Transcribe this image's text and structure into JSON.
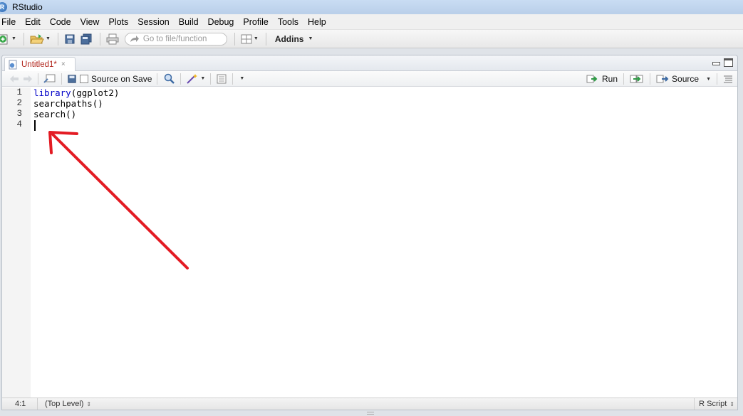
{
  "window": {
    "title": "RStudio",
    "app_icon": "R"
  },
  "menu": [
    "File",
    "Edit",
    "Code",
    "View",
    "Plots",
    "Session",
    "Build",
    "Debug",
    "Profile",
    "Tools",
    "Help"
  ],
  "toolbar": {
    "goto_placeholder": "Go to file/function",
    "addins_label": "Addins"
  },
  "editor": {
    "tab_label": "Untitled1*",
    "tab_close": "×",
    "source_on_save_label": "Source on Save",
    "run_label": "Run",
    "source_label": "Source",
    "lines": [
      {
        "num": "1",
        "kw": "library",
        "rest": "(ggplot2)"
      },
      {
        "num": "2",
        "kw": "",
        "rest": "searchpaths()"
      },
      {
        "num": "3",
        "kw": "",
        "rest": "search()"
      },
      {
        "num": "4",
        "kw": "",
        "rest": ""
      }
    ]
  },
  "status": {
    "position": "4:1",
    "scope": "(Top Level)",
    "file_type": "R Script"
  },
  "colors": {
    "keyword": "#0000c8",
    "annotation_arrow": "#e31b23",
    "tab_label": "#b1251c"
  },
  "icons": [
    "new-file-icon",
    "open-folder-icon",
    "save-icon",
    "save-all-icon",
    "print-icon",
    "goto-arrow-icon",
    "grid-layout-icon",
    "back-icon",
    "forward-icon",
    "show-in-window-icon",
    "search-icon",
    "magic-wand-icon",
    "compile-report-icon",
    "run-icon",
    "rerun-icon",
    "source-icon",
    "outline-icon"
  ]
}
